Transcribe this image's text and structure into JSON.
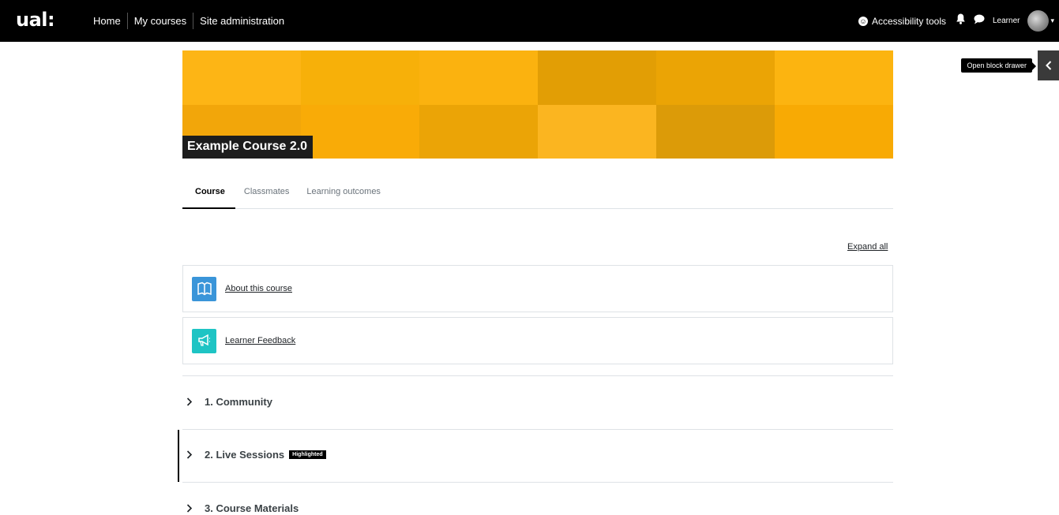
{
  "navbar": {
    "logo": "ual:",
    "links": [
      "Home",
      "My courses",
      "Site administration"
    ],
    "accessibility_label": "Accessibility tools",
    "user_name": "Learner"
  },
  "drawer": {
    "tooltip": "Open block drawer"
  },
  "course": {
    "title": "Example Course 2.0"
  },
  "banner_colors": [
    "#fdb515",
    "#f7b009",
    "#fbb20f",
    "#e29e05",
    "#eba405",
    "#fcb410",
    "#f2a60a",
    "#f9ab07",
    "#eba406",
    "#fbb520",
    "#dc9b08",
    "#f8aa04"
  ],
  "tabs": [
    "Course",
    "Classmates",
    "Learning outcomes"
  ],
  "expand_all": "Expand all",
  "activities": [
    {
      "label": "About this course",
      "icon": "book-icon",
      "color": "#3a95d9"
    },
    {
      "label": "Learner Feedback",
      "icon": "megaphone-icon",
      "color": "#1ec4c4"
    }
  ],
  "sections": [
    {
      "title": "1. Community"
    },
    {
      "title": "2. Live Sessions",
      "badge": "Highlighted"
    },
    {
      "title": "3. Course Materials"
    }
  ]
}
